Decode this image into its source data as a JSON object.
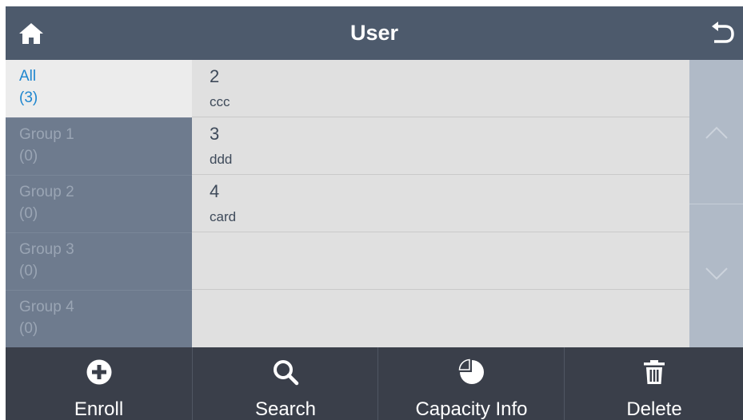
{
  "header": {
    "title": "User",
    "home_icon": "home-icon",
    "back_icon": "back-arrow-icon"
  },
  "groups": [
    {
      "name": "All",
      "count": "(3)",
      "selected": true
    },
    {
      "name": "Group 1",
      "count": "(0)",
      "selected": false
    },
    {
      "name": "Group 2",
      "count": "(0)",
      "selected": false
    },
    {
      "name": "Group 3",
      "count": "(0)",
      "selected": false
    },
    {
      "name": "Group 4",
      "count": "(0)",
      "selected": false
    }
  ],
  "users": [
    {
      "id": "2",
      "name": "ccc"
    },
    {
      "id": "3",
      "name": "ddd"
    },
    {
      "id": "4",
      "name": "card"
    },
    {
      "id": "",
      "name": ""
    },
    {
      "id": "",
      "name": ""
    }
  ],
  "scroll": {
    "up_icon": "chevron-up-icon",
    "down_icon": "chevron-down-icon"
  },
  "toolbar": {
    "enroll_label": "Enroll",
    "search_label": "Search",
    "capacity_label": "Capacity Info",
    "delete_label": "Delete"
  },
  "colors": {
    "header": "#4d5a6c",
    "sidebar": "#6e7b8e",
    "selected_text": "#1e86cf",
    "toolbar": "#3a3f4a",
    "list_bg": "#e0e0e0"
  }
}
